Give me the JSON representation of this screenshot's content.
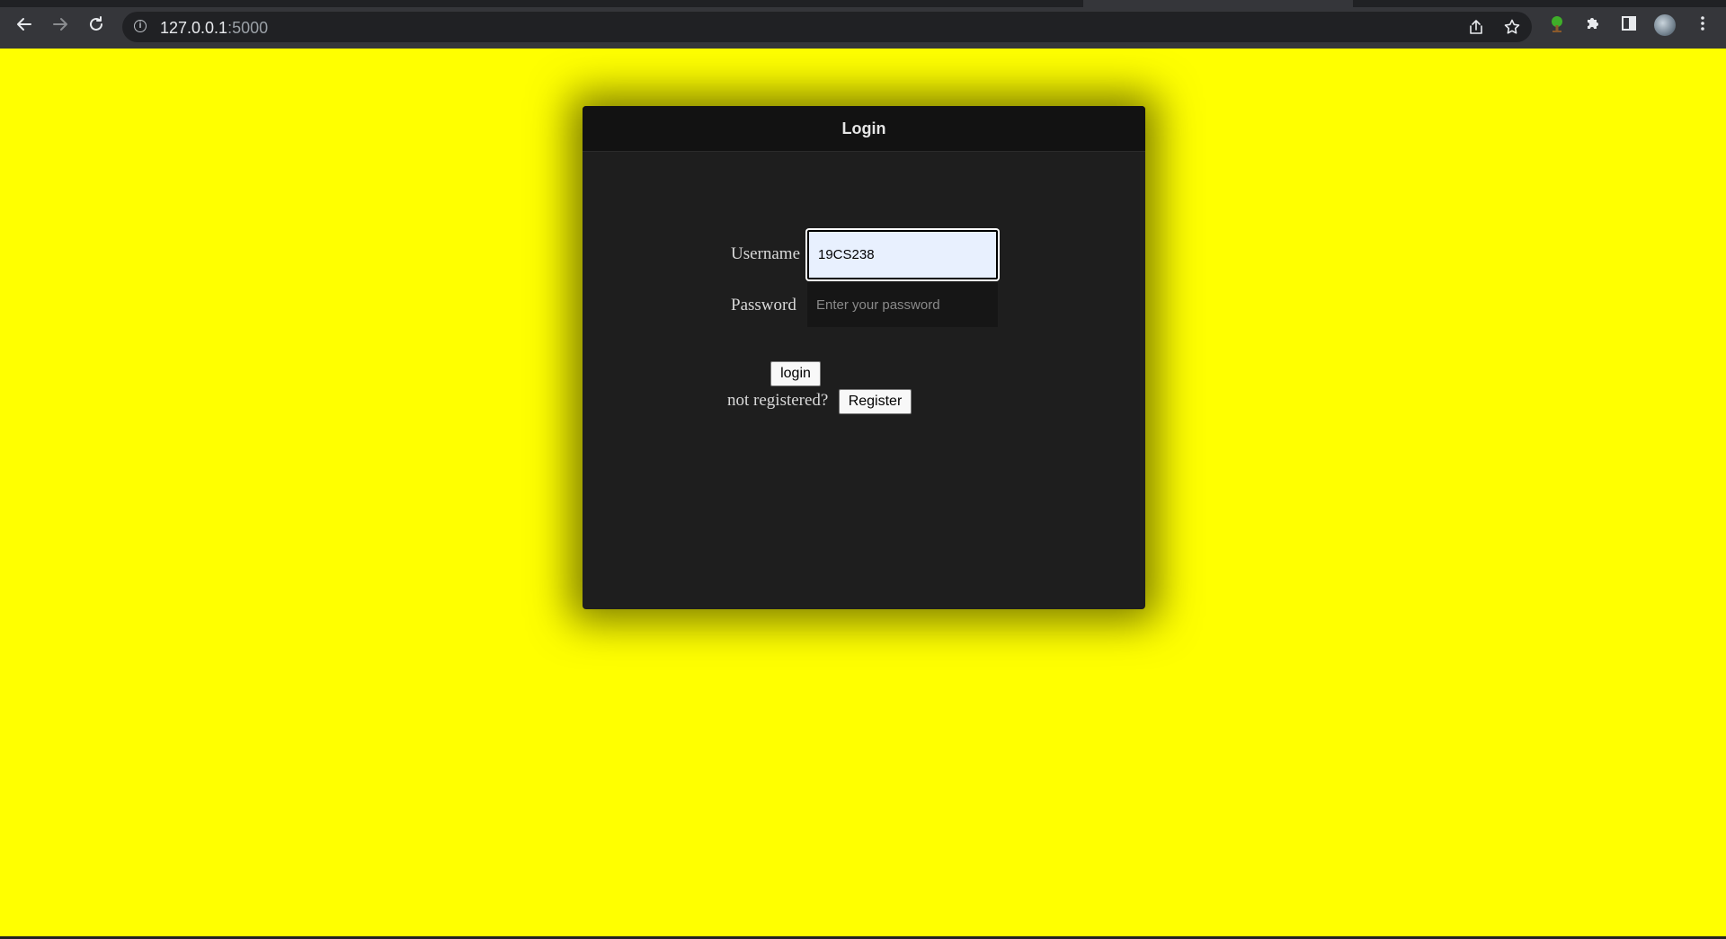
{
  "browser": {
    "url_host": "127.0.0.1",
    "url_port": ":5000"
  },
  "login": {
    "title": "Login",
    "username_label": "Username",
    "username_value": "19CS238",
    "password_label": "Password",
    "password_placeholder": "Enter your password",
    "login_button": "login",
    "not_registered_text": "not registered?",
    "register_button": "Register"
  },
  "colors": {
    "page_background": "#ffff00",
    "card_background": "#1e1e1e",
    "card_header_background": "#121212"
  }
}
